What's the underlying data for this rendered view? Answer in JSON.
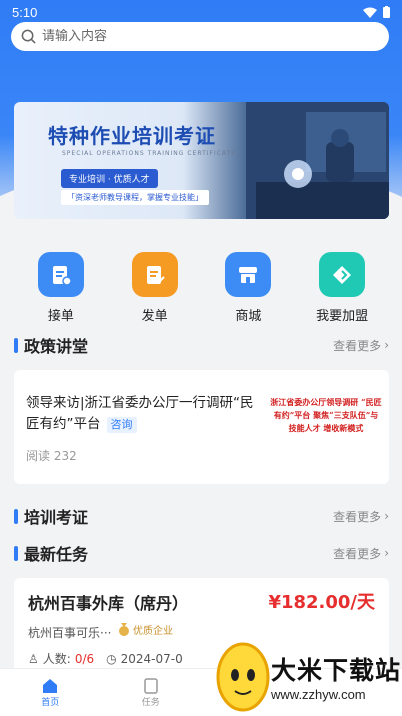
{
  "status": {
    "time": "5:10"
  },
  "search": {
    "placeholder": "请输入内容"
  },
  "banner": {
    "title": "特种作业培训考证",
    "subtitle": "SPECIAL OPERATIONS TRAINING CERTIFICATE",
    "tag": "专业培训 · 优质人才",
    "line": "「资深老师教导课程，掌握专业技能」"
  },
  "quick_nav": [
    {
      "label": "接单",
      "icon": "order-receive-icon",
      "color": "#3d8cf5"
    },
    {
      "label": "发单",
      "icon": "order-publish-icon",
      "color": "#f59a23"
    },
    {
      "label": "商城",
      "icon": "shop-icon",
      "color": "#3d8cf5"
    },
    {
      "label": "我要加盟",
      "icon": "join-icon",
      "color": "#1fc9b4"
    }
  ],
  "sections": {
    "policy": {
      "title": "政策讲堂",
      "more": "查看更多"
    },
    "training": {
      "title": "培训考证",
      "more": "查看更多"
    },
    "tasks": {
      "title": "最新任务",
      "more": "查看更多"
    }
  },
  "policy_item": {
    "title": "领导来访|浙江省委办公厅一行调研“民匠有约”平台",
    "tag": "咨询",
    "reads": "阅读 232",
    "image_text": "浙江省委办公厅领导调研 “民匠有约”平台 聚焦“三支队伍”与技能人才 增收新模式"
  },
  "task_item": {
    "title": "杭州百事外库（席丹）",
    "price": "¥182.00/天",
    "company": "杭州百事可乐···",
    "badge": "优质企业",
    "people_label": "人数:",
    "people_value": "0/6",
    "date": "2024-07-0"
  },
  "tabbar": [
    {
      "label": "首页",
      "active": true
    },
    {
      "label": "任务",
      "active": false
    },
    {
      "label": "",
      "active": false
    },
    {
      "label": "",
      "active": false
    }
  ],
  "watermark": {
    "text": "大米下载站",
    "url": "www.zzhyw.com"
  },
  "colors": {
    "primary": "#2f7cf6",
    "price": "#e62e2e",
    "badge": "#c9902c"
  }
}
